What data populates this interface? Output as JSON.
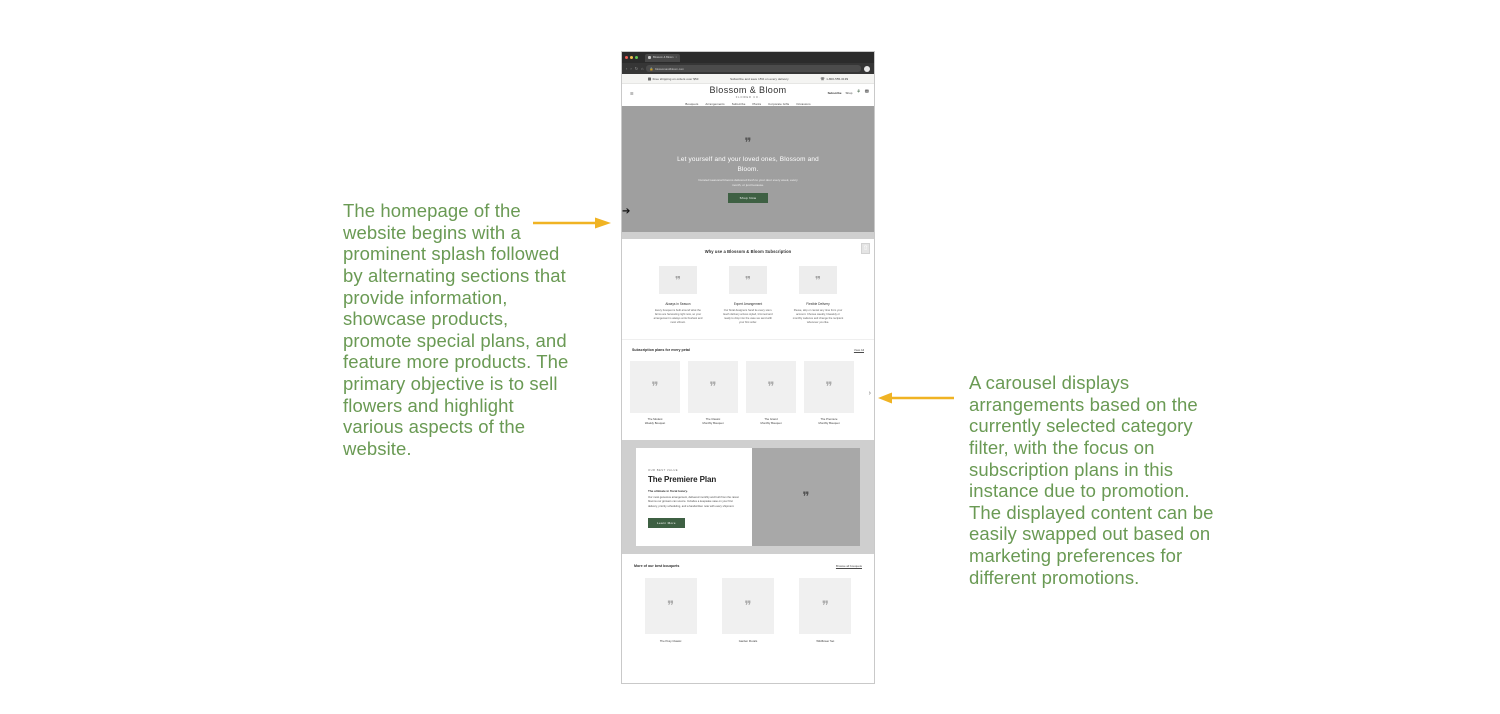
{
  "annotations": {
    "left": "The homepage of the website begins with a prominent splash followed by alternating sections that provide information, showcase products, promote special plans, and feature more products. The primary objective is to sell flowers and highlight various aspects of the website.",
    "right": "A carousel displays arrangements based on the currently selected category filter, with the focus on subscription plans in this instance due to promotion. The displayed content can be easily swapped out based on marketing preferences for different promotions.",
    "arrow_color": "#f0b323",
    "text_color": "#6a9a54"
  },
  "browser": {
    "tab_title": "Blossom & Bloom",
    "url": "blossomandbloom.com",
    "back_icon": "back-arrow-icon",
    "forward_icon": "forward-arrow-icon",
    "reload_icon": "reload-icon",
    "home_icon": "home-icon",
    "lock_icon": "lock-icon",
    "profile_icon": "profile-avatar-icon"
  },
  "site": {
    "announcement": [
      {
        "icon": "truck-icon",
        "text": "Free shipping on orders over $50"
      },
      {
        "icon": "",
        "text": "Subscribe and save 15% on every delivery"
      },
      {
        "icon": "phone-icon",
        "text": "1-800-555-0199"
      }
    ],
    "header": {
      "menu_icon": "hamburger-menu-icon",
      "logo_mark": "Blossom & Bloom",
      "logo_sub": "FLOWER CO.",
      "links": [
        {
          "label": "Subscribe",
          "bold": true
        },
        {
          "label": "Shop",
          "bold": false
        }
      ],
      "icons": [
        {
          "name": "account-icon",
          "glyph": "⚘"
        },
        {
          "name": "cart-icon",
          "glyph": "⛃"
        }
      ]
    },
    "nav": [
      "Bouquets",
      "Arrangements",
      "Subscribe",
      "Plants",
      "Corporate Gifts",
      "Occasions"
    ],
    "hero": {
      "image": "hero-flowers-placeholder",
      "heading": "Let yourself and your loved ones, Blossom and Bloom.",
      "subheading": "Curated seasonal blooms delivered fresh to your door every week, every month, or just because.",
      "cta": "Shop Now"
    },
    "features": {
      "title": "Why use a Blossom & Bloom Subscription",
      "back_to_top_icon": "arrow-up-icon",
      "items": [
        {
          "image": "feature-image-placeholder",
          "title": "Always in Season",
          "body": "Every bouquet is built around what the farms are harvesting right now, so your arrangement is always at its freshest and most vibrant."
        },
        {
          "image": "feature-image-placeholder",
          "title": "Expert Arrangement",
          "body": "Our floral designers hand tie every stem. Each delivery arrives styled, trimmed and ready to drop into the vase we send with your first order."
        },
        {
          "image": "feature-image-placeholder",
          "title": "Flexible Delivery",
          "body": "Pause, skip or cancel any time from your account. Choose weekly, biweekly or monthly cadence and change the recipient whenever you like."
        }
      ]
    },
    "carousel": {
      "title": "Subscription plans for every petal",
      "more_label": "View All",
      "next_icon": "chevron-right-icon",
      "cards": [
        {
          "image": "product-image-placeholder",
          "caption": "The Modest\nWeekly Bouquet"
        },
        {
          "image": "product-image-placeholder",
          "caption": "The Classic\nMonthly Bouquet"
        },
        {
          "image": "product-image-placeholder",
          "caption": "The Grand\nMonthly Bouquet"
        },
        {
          "image": "product-image-placeholder",
          "caption": "The Premiere\nMonthly Bouquet"
        }
      ]
    },
    "promo": {
      "eyebrow": "OUR BEST VALUE",
      "heading": "The Premiere Plan",
      "lead": "The ultimate in floral luxury.",
      "body": "Our most generous arrangement, delivered monthly and built from the rarest blooms our growers can source. Includes a keepsake vase on your first delivery, priority scheduling, and a handwritten note with every shipment.",
      "cta": "Learn More",
      "image": "premiere-plan-image-placeholder"
    },
    "products": {
      "title": "More of our best bouquets",
      "more_label": "Browse all bouquets",
      "items": [
        {
          "image": "product-image-placeholder",
          "caption": "The Posy Classic"
        },
        {
          "image": "product-image-placeholder",
          "caption": "Garden Florals"
        },
        {
          "image": "product-image-placeholder",
          "caption": "Wildflower Set"
        }
      ]
    }
  }
}
